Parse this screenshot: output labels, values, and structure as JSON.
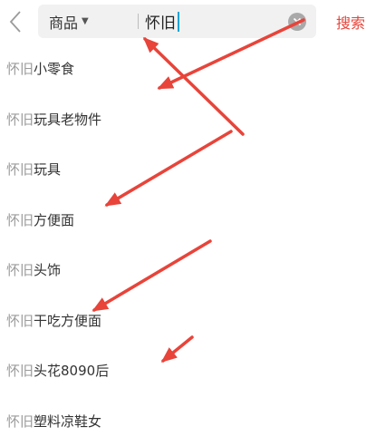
{
  "header": {
    "scope_label": "商品",
    "query": "怀旧",
    "search_label": "搜索"
  },
  "suggestions": [
    {
      "prefix": "怀旧",
      "rest": "小零食"
    },
    {
      "prefix": "怀旧",
      "rest": "玩具老物件"
    },
    {
      "prefix": "怀旧",
      "rest": "玩具"
    },
    {
      "prefix": "怀旧",
      "rest": "方便面"
    },
    {
      "prefix": "怀旧",
      "rest": "头饰"
    },
    {
      "prefix": "怀旧",
      "rest": "干吃方便面"
    },
    {
      "prefix": "怀旧",
      "rest": "头花8090后"
    },
    {
      "prefix": "怀旧",
      "rest": "塑料凉鞋女"
    }
  ],
  "colors": {
    "accent": "#e8443a",
    "annotation_arrow": "#e8443a",
    "highlight_text": "#9a9a9a"
  },
  "icons": [
    "back-chevron-icon",
    "caret-down-icon",
    "clear-icon"
  ]
}
